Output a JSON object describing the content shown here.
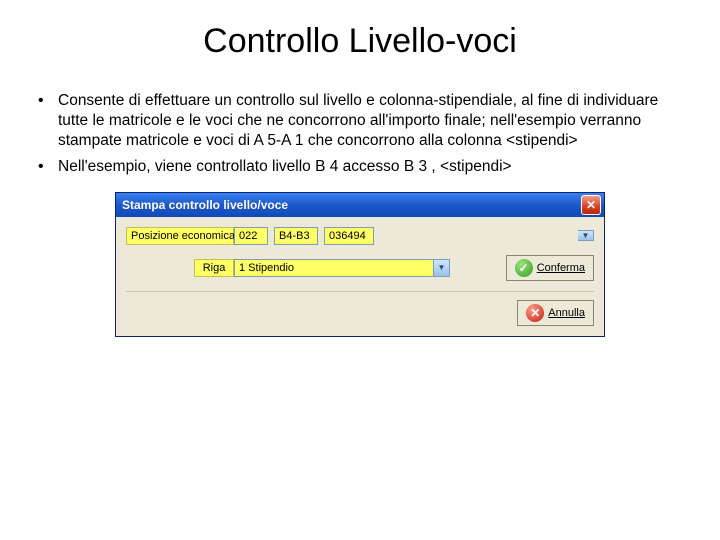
{
  "title": "Controllo Livello-voci",
  "bullets": [
    "Consente di effettuare un controllo sul livello e  colonna-stipendiale, al fine di individuare tutte le matricole e le voci che ne concorrono all'importo finale; nell'esempio verranno stampate  matricole e voci di A 5-A 1 che concorrono alla colonna <stipendi>",
    "Nell'esempio, viene controllato livello B 4  accesso B 3 , <stipendi>"
  ],
  "dialog": {
    "title": "Stampa controllo livello/voce",
    "row1": {
      "label": "Posizione economica",
      "code": "022",
      "level": "B4-B3",
      "num": "036494"
    },
    "row2": {
      "label": "Riga",
      "value": "1 Stipendio"
    },
    "buttons": {
      "confirm": "Conferma",
      "cancel": "Annulla"
    }
  }
}
